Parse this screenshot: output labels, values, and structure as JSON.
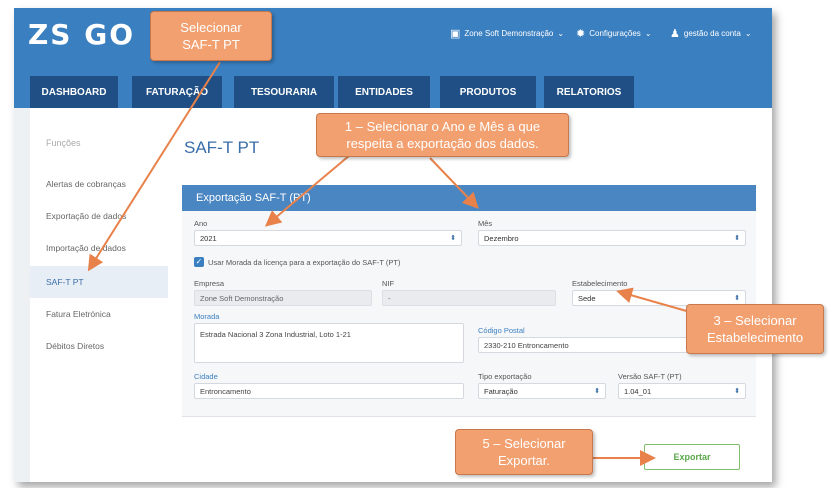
{
  "app": {
    "logo": "ZS GO"
  },
  "topmenu": {
    "company": "Zone Soft Demonstração",
    "settings": "Configurações",
    "account": "gestão da conta",
    "chevron": "⌄"
  },
  "tabs": [
    "DASHBOARD",
    "FATURAÇÃO",
    "TESOURARIA",
    "ENTIDADES",
    "PRODUTOS",
    "RELATORIOS"
  ],
  "sidebar": {
    "title": "Funções",
    "items": [
      "Alertas de cobranças",
      "Exportação de dados",
      "Importação de dados",
      "SAF-T PT",
      "Fatura Eletrónica",
      "Débitos Diretos"
    ]
  },
  "main": {
    "title": "SAF-T PT",
    "section": "Exportação SAF-T (PT)"
  },
  "form": {
    "ano_label": "Ano",
    "ano_value": "2021",
    "mes_label": "Mês",
    "mes_value": "Dezembro",
    "checkbox_label": "Usar Morada da licença para a exportação do SAF-T (PT)",
    "empresa_label": "Empresa",
    "empresa_value": "Zone Soft Demonstração",
    "nif_label": "NIF",
    "nif_value": "-",
    "estab_label": "Estabelecimento",
    "estab_value": "Sede",
    "morada_label": "Morada",
    "morada_value": "Estrada Nacional 3 Zona Industrial, Loto 1-21",
    "cp_label": "Código Postal",
    "cp_value": "2330-210 Entroncamento",
    "cidade_label": "Cidade",
    "cidade_value": "Entroncamento",
    "tipo_label": "Tipo exportação",
    "tipo_value": "Faturação",
    "versao_label": "Versão SAF-T (PT)",
    "versao_value": "1.04_01",
    "export_button": "Exportar",
    "dropdown_arrow": "⬍"
  },
  "callouts": {
    "c0_line1": "Selecionar",
    "c0_line2": "SAF-T PT",
    "c1_line1": "1 – Selecionar o Ano e Mês a que",
    "c1_line2": "respeita a exportação dos dados.",
    "c3_line1": "3 – Selecionar",
    "c3_line2": "Estabelecimento",
    "c5_line1": "5 – Selecionar",
    "c5_line2": "Exportar."
  },
  "colors": {
    "topbar": "#3a7fc0",
    "tab": "#1f4f84",
    "section": "#4a86c2",
    "callout": "#f2a070",
    "arrow": "#e8824a",
    "export_border": "#7fbf6a"
  }
}
